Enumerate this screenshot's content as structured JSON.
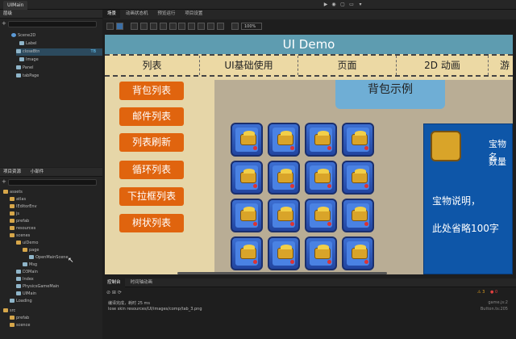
{
  "window": {
    "doc_tab": "UIMain"
  },
  "hierarchy": {
    "title": "层级",
    "items": [
      {
        "label": "Scene2D"
      },
      {
        "label": "Label"
      },
      {
        "label": "closeBtn",
        "badge": "TB"
      },
      {
        "label": "Image"
      },
      {
        "label": "Panel"
      },
      {
        "label": "tabPage"
      }
    ]
  },
  "assets": {
    "tab_project": "项目资源",
    "tab_widgets": "小部件",
    "items": [
      {
        "label": "assets"
      },
      {
        "label": "atlas"
      },
      {
        "label": "IEditorEnv"
      },
      {
        "label": "js"
      },
      {
        "label": "prefab"
      },
      {
        "label": "resources"
      },
      {
        "label": "scenes"
      },
      {
        "label": "uiDemo"
      },
      {
        "label": "page"
      },
      {
        "label": "OpenMainScene"
      },
      {
        "label": "Msg"
      },
      {
        "label": "D3Main"
      },
      {
        "label": "Index"
      },
      {
        "label": "PhysicsGameMain"
      },
      {
        "label": "UIMain"
      },
      {
        "label": "Loading"
      },
      {
        "label": "src"
      },
      {
        "label": "prefab"
      },
      {
        "label": "scence"
      }
    ]
  },
  "editor": {
    "tabs": [
      {
        "label": "场景"
      },
      {
        "label": "动画状态机"
      },
      {
        "label": "预览运行"
      },
      {
        "label": "项目设置"
      }
    ],
    "zoom": "100%"
  },
  "scene": {
    "title": "UI Demo",
    "tabs": [
      "列表",
      "UI基础使用",
      "页面",
      "2D 动画",
      "游"
    ],
    "left_buttons": [
      "背包列表",
      "邮件列表",
      "列表刷新",
      "循环列表",
      "下拉框列表",
      "树状列表"
    ],
    "package_title": "背包示例",
    "detail": {
      "line1": "宝物名",
      "line2": "数量",
      "line3": "宝物说明，",
      "line4": "此处省略100字"
    }
  },
  "console": {
    "tab_console": "控制台",
    "tab_timeline": "时间轴动画",
    "badge_warn": "3",
    "badge_info": "0",
    "lines": [
      {
        "text": "编译完成，耗时 25 ms",
        "src": "game.js:2"
      },
      {
        "text": "lose skin resources/UI/images/comp/tab_3.png",
        "src": "Button.ts:205"
      }
    ]
  }
}
